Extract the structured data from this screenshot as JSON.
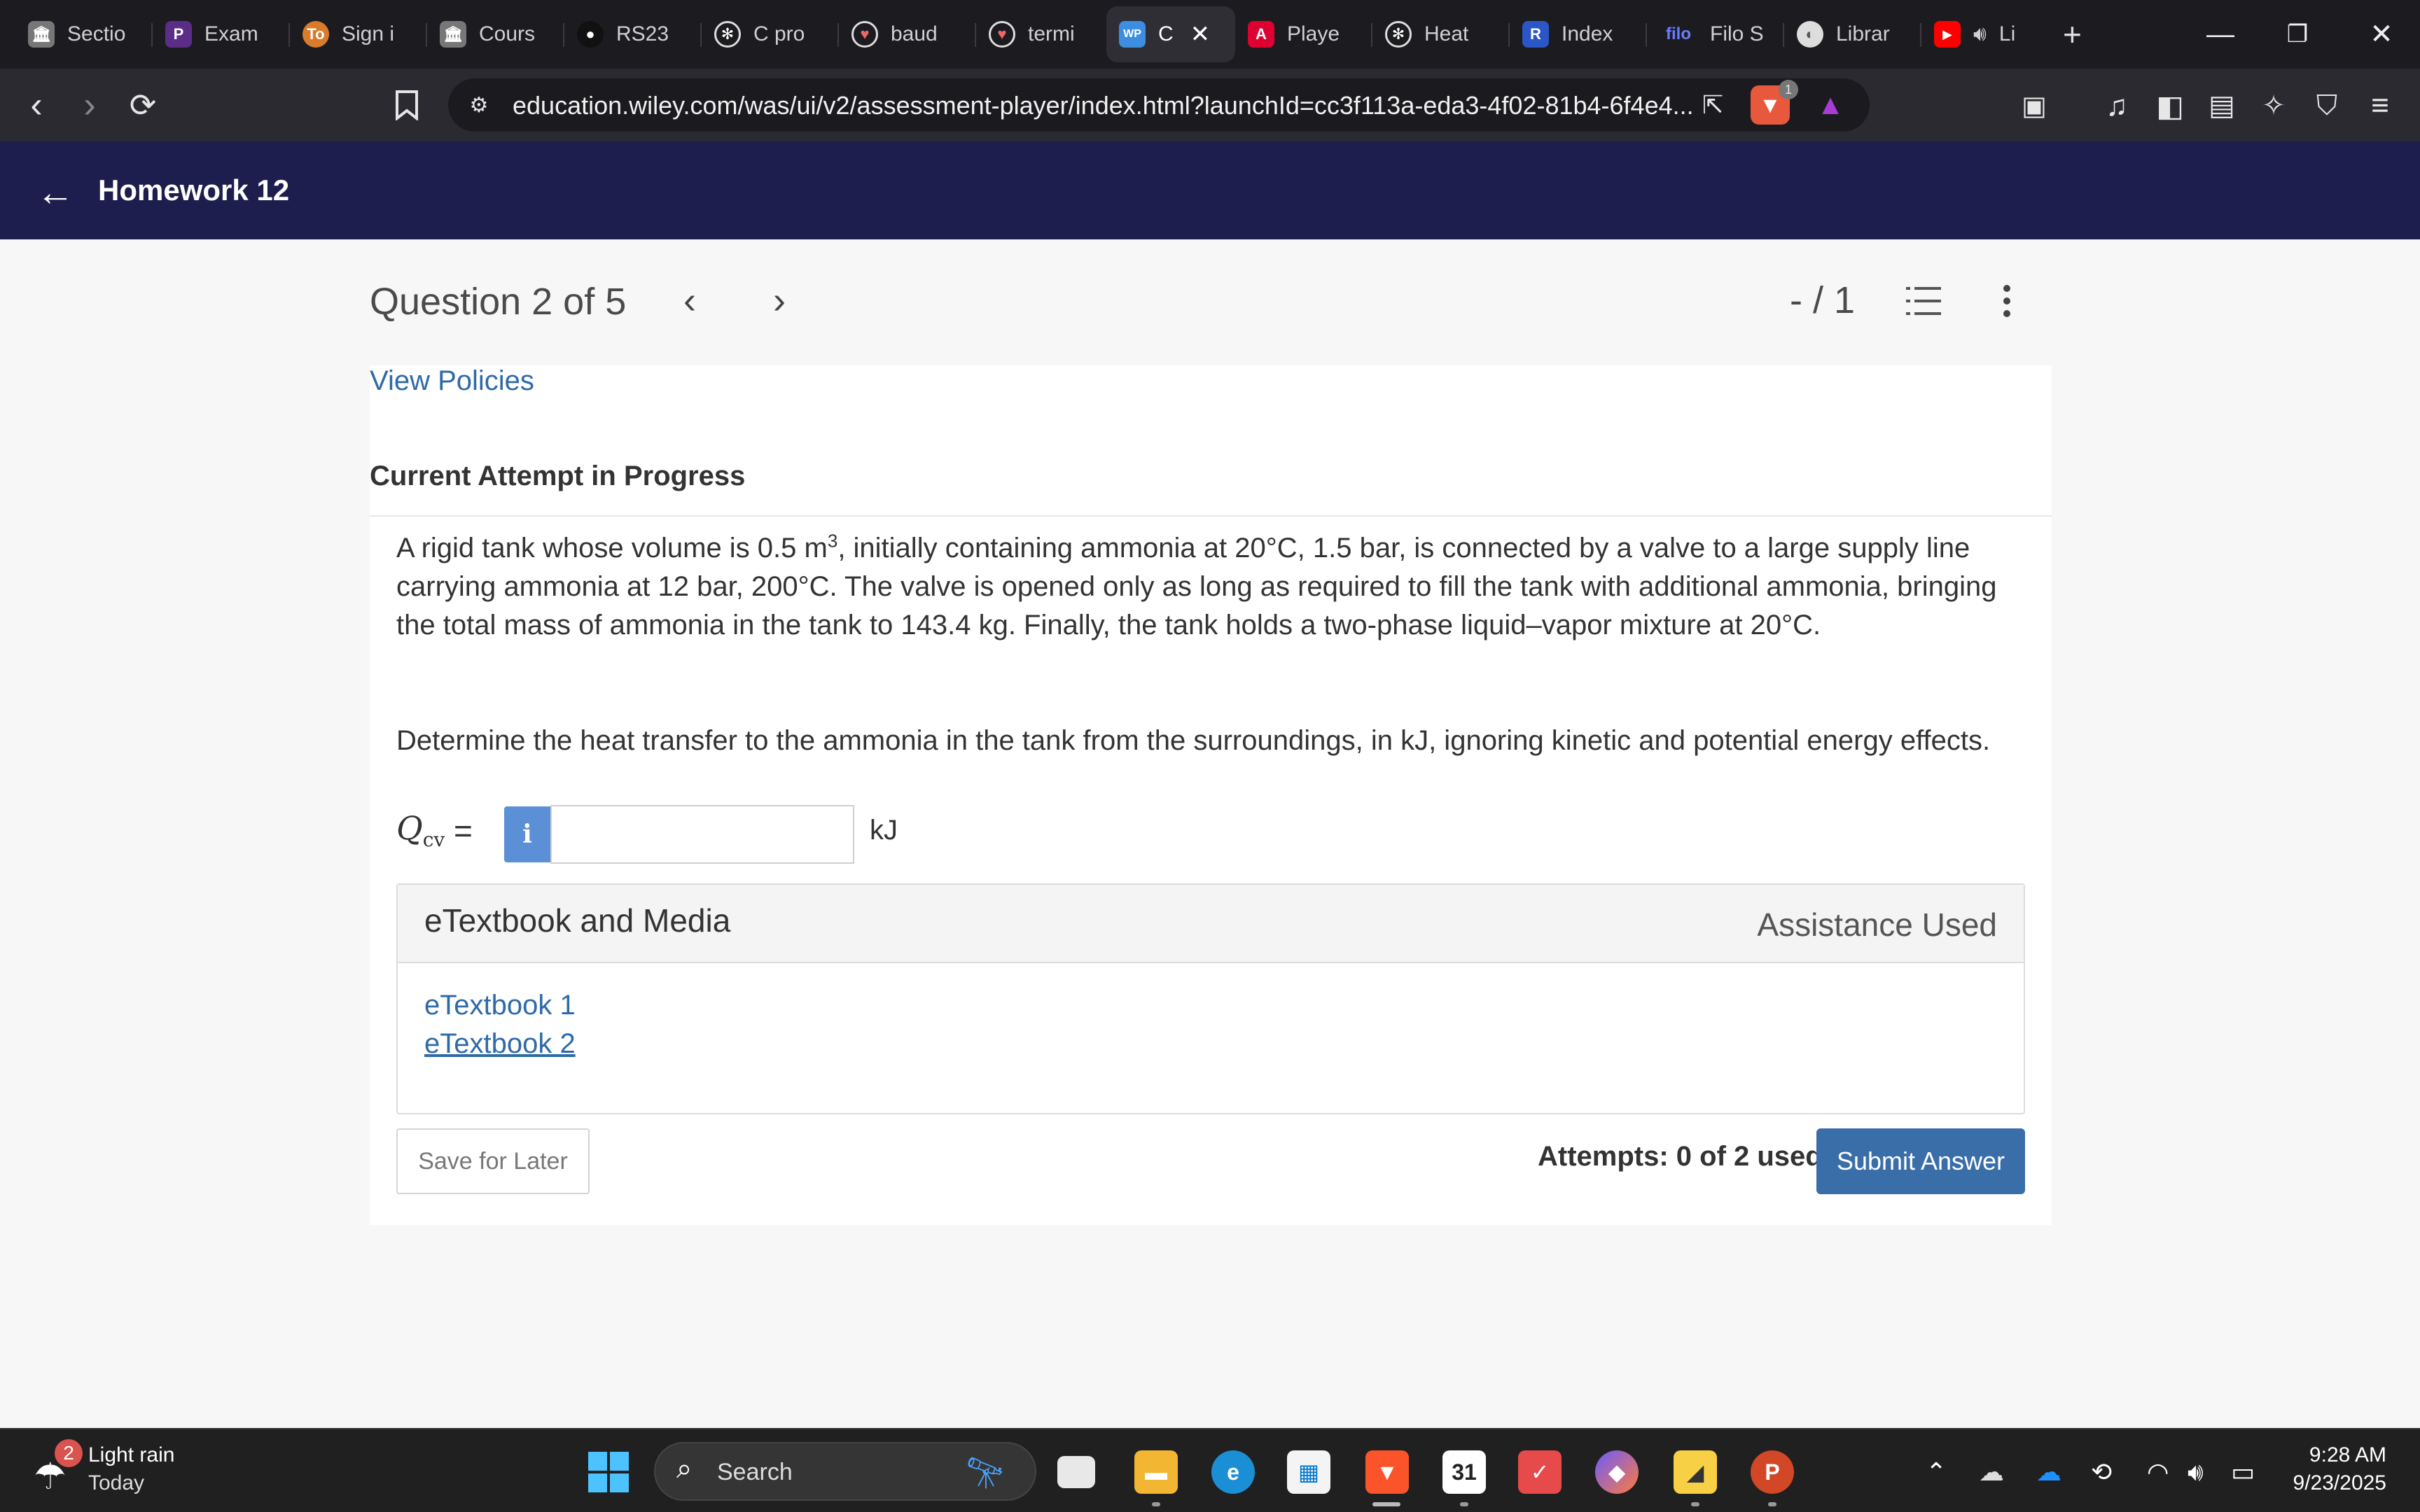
{
  "browser": {
    "tabs": [
      {
        "label": "Sectio",
        "icon": "bank-icon",
        "color": "#888888"
      },
      {
        "label": "Exam",
        "icon": "pearson-icon",
        "color": "#5b2d86"
      },
      {
        "label": "Sign i",
        "icon": "orange-circle-icon",
        "color": "#d97b2b"
      },
      {
        "label": "Cours",
        "icon": "bank-icon",
        "color": "#888888"
      },
      {
        "label": "RS23",
        "icon": "logo-icon",
        "color": "#111111"
      },
      {
        "label": "C pro",
        "icon": "openai-icon",
        "color": "#1c1c20"
      },
      {
        "label": "baud",
        "icon": "brave-search-icon",
        "color": "#444444"
      },
      {
        "label": "termi",
        "icon": "brave-search-icon",
        "color": "#444444"
      },
      {
        "label": "C",
        "icon": "wp-icon",
        "color": "#3d8de0",
        "active": true
      },
      {
        "label": "Playe",
        "icon": "angular-icon",
        "color": "#dd0031"
      },
      {
        "label": "Heat",
        "icon": "openai-icon",
        "color": "#1c1c20"
      },
      {
        "label": "Index",
        "icon": "blue-logo-icon",
        "color": "#2a56c6"
      },
      {
        "label": "Filo S",
        "icon": "filo-icon",
        "color": "#1c1c20"
      },
      {
        "label": "Librar",
        "icon": "globe-icon",
        "color": "#666666"
      },
      {
        "label": "Li",
        "icon": "youtube-icon",
        "color": "#ff0000"
      }
    ],
    "url": "education.wiley.com/was/ui/v2/assessment-player/index.html?launchId=cc3f113a-eda3-4f02-81b4-6f4e4...",
    "shield_badge": "1"
  },
  "header": {
    "title": "Homework 12"
  },
  "question": {
    "position": "Question 2 of 5",
    "score": "- / 1",
    "view_policies": "View Policies",
    "attempt_status": "Current Attempt in Progress",
    "problem_before": "A rigid tank whose volume is 0.5 m",
    "problem_sup": "3",
    "problem_after": ", initially containing ammonia at 20°C, 1.5 bar, is connected by a valve to a large supply line carrying ammonia at 12 bar, 200°C. The valve is opened only as long as required to fill the tank with additional ammonia, bringing the total mass of ammonia in the tank to 143.4 kg. Finally, the tank holds a two-phase liquid–vapor mixture at 20°C.",
    "determine": "Determine the heat transfer to the ammonia in the tank from the surroundings, in kJ, ignoring kinetic and potential energy effects.",
    "answer_symbol": "Q",
    "answer_subscript": "cv",
    "answer_equals": "=",
    "answer_value": "",
    "answer_unit": "kJ",
    "info_glyph": "i"
  },
  "media": {
    "title": "eTextbook and Media",
    "assistance": "Assistance Used",
    "links": [
      "eTextbook 1",
      "eTextbook 2"
    ]
  },
  "actions": {
    "save_label": "Save for Later",
    "attempts": "Attempts: 0 of 2 used",
    "submit_label": "Submit Answer"
  },
  "taskbar": {
    "weather_badge": "2",
    "weather_condition": "Light rain",
    "weather_day": "Today",
    "search_label": "Search",
    "time": "9:28 AM",
    "date": "9/23/2025"
  },
  "colors": {
    "header_bg": "#1d1e4e",
    "link": "#2f6aa8",
    "submit_bg": "#3a6ea8",
    "info_bg": "#5b8fd6"
  }
}
